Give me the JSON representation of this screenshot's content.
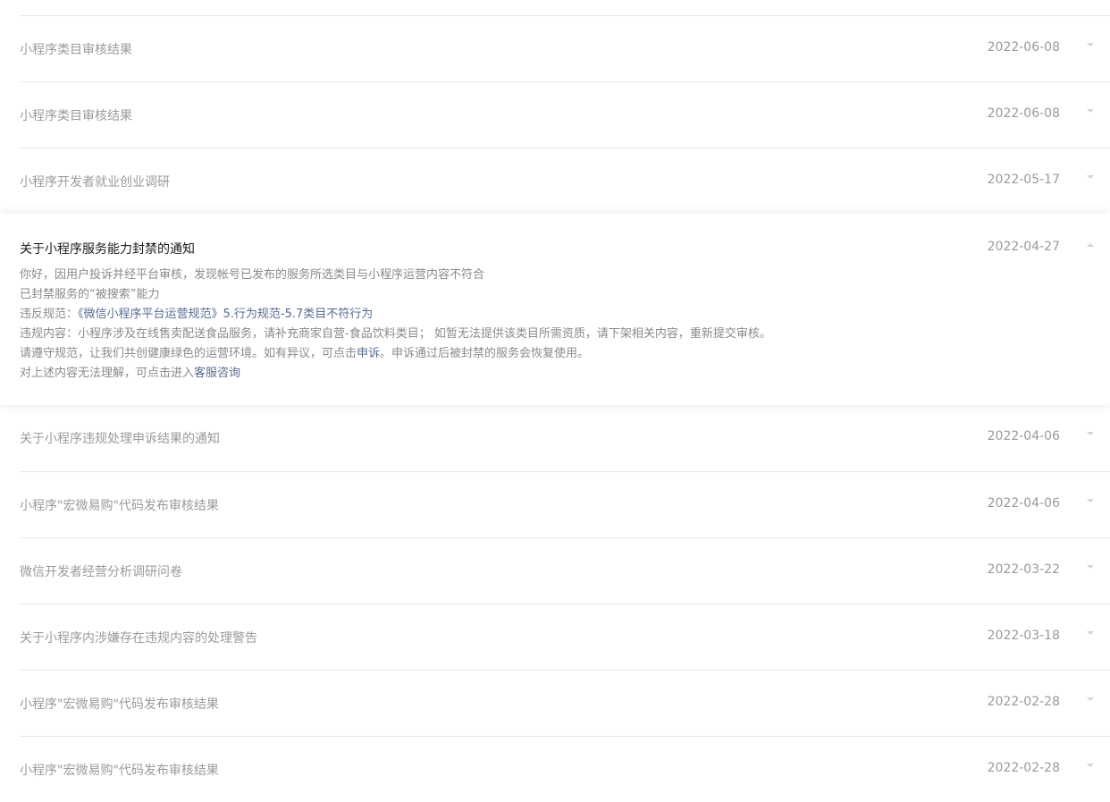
{
  "rows_top": [
    {
      "title": "小程序类目审核结果",
      "date": "2022-06-08"
    },
    {
      "title": "小程序类目审核结果",
      "date": "2022-06-08"
    },
    {
      "title": "小程序开发者就业创业调研",
      "date": "2022-05-17"
    }
  ],
  "expanded": {
    "title": "关于小程序服务能力封禁的通知",
    "date": "2022-04-27",
    "line1": "你好，因用户投诉并经平台审核，发现帐号已发布的服务所选类目与小程序运营内容不符合",
    "line2": "已封禁服务的“被搜索”能力",
    "line3_prefix": "违反规范：",
    "line3_link": "《微信小程序平台运营规范》5.行为规范-5.7类目不符行为",
    "line4": "违规内容：小程序涉及在线售卖配送食品服务，请补充商家自营-食品饮料类目； 如暂无法提供该类目所需资质，请下架相关内容，重新提交审核。",
    "line5_prefix": "请遵守规范，让我们共创健康绿色的运营环境。如有异议，可点击",
    "line5_link": "申诉",
    "line5_suffix": "。申诉通过后被封禁的服务会恢复使用。",
    "line6_prefix": "对上述内容无法理解，可点击进入",
    "line6_link": "客服咨询"
  },
  "rows_bottom": [
    {
      "title": "关于小程序违规处理申诉结果的通知",
      "date": "2022-04-06"
    },
    {
      "title": "小程序\"宏微易购\"代码发布审核结果",
      "date": "2022-04-06"
    },
    {
      "title": "微信开发者经营分析调研问卷",
      "date": "2022-03-22"
    },
    {
      "title": "关于小程序内涉嫌存在违规内容的处理警告",
      "date": "2022-03-18"
    },
    {
      "title": "小程序\"宏微易购\"代码发布审核结果",
      "date": "2022-02-28"
    },
    {
      "title": "小程序\"宏微易购\"代码发布审核结果",
      "date": "2022-02-28"
    }
  ]
}
